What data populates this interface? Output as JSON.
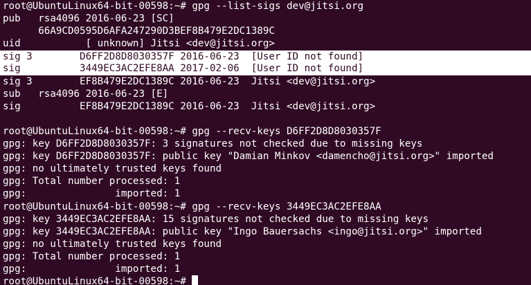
{
  "terminal": {
    "lines": [
      "root@UbuntuLinux64-bit-00598:~# gpg --list-sigs dev@jitsi.org",
      "pub   rsa4096 2016-06-23 [SC]",
      "      66A9CD0595D6AFA247290D3BEF8B479E2DC1389C",
      "uid           [ unknown] Jitsi <dev@jitsi.org>",
      "sig 3        D6FF2D8D8030357F 2016-06-23  [User ID not found]",
      "sig          3449EC3AC2EFE8AA 2017-02-06  [User ID not found]",
      "sig 3        EF8B479E2DC1389C 2016-06-23  Jitsi <dev@jitsi.org>",
      "sub   rsa4096 2016-06-23 [E]",
      "sig          EF8B479E2DC1389C 2016-06-23  Jitsi <dev@jitsi.org>",
      "",
      "root@UbuntuLinux64-bit-00598:~# gpg --recv-keys D6FF2D8D8030357F",
      "gpg: key D6FF2D8D8030357F: 3 signatures not checked due to missing keys",
      "gpg: key D6FF2D8D8030357F: public key \"Damian Minkov <damencho@jitsi.org>\" imported",
      "gpg: no ultimately trusted keys found",
      "gpg: Total number processed: 1",
      "gpg:               imported: 1",
      "root@UbuntuLinux64-bit-00598:~# gpg --recv-keys 3449EC3AC2EFE8AA",
      "gpg: key 3449EC3AC2EFE8AA: 15 signatures not checked due to missing keys",
      "gpg: key 3449EC3AC2EFE8AA: public key \"Ingo Bauersachs <ingo@jitsi.org>\" imported",
      "gpg: no ultimately trusted keys found",
      "gpg: Total number processed: 1",
      "gpg:               imported: 1"
    ],
    "prompt": "root@UbuntuLinux64-bit-00598:~# "
  },
  "colors": {
    "background": "#300a24",
    "foreground": "#ffffff",
    "highlight_background": "#ffffff",
    "highlight_foreground": "#300a24"
  }
}
